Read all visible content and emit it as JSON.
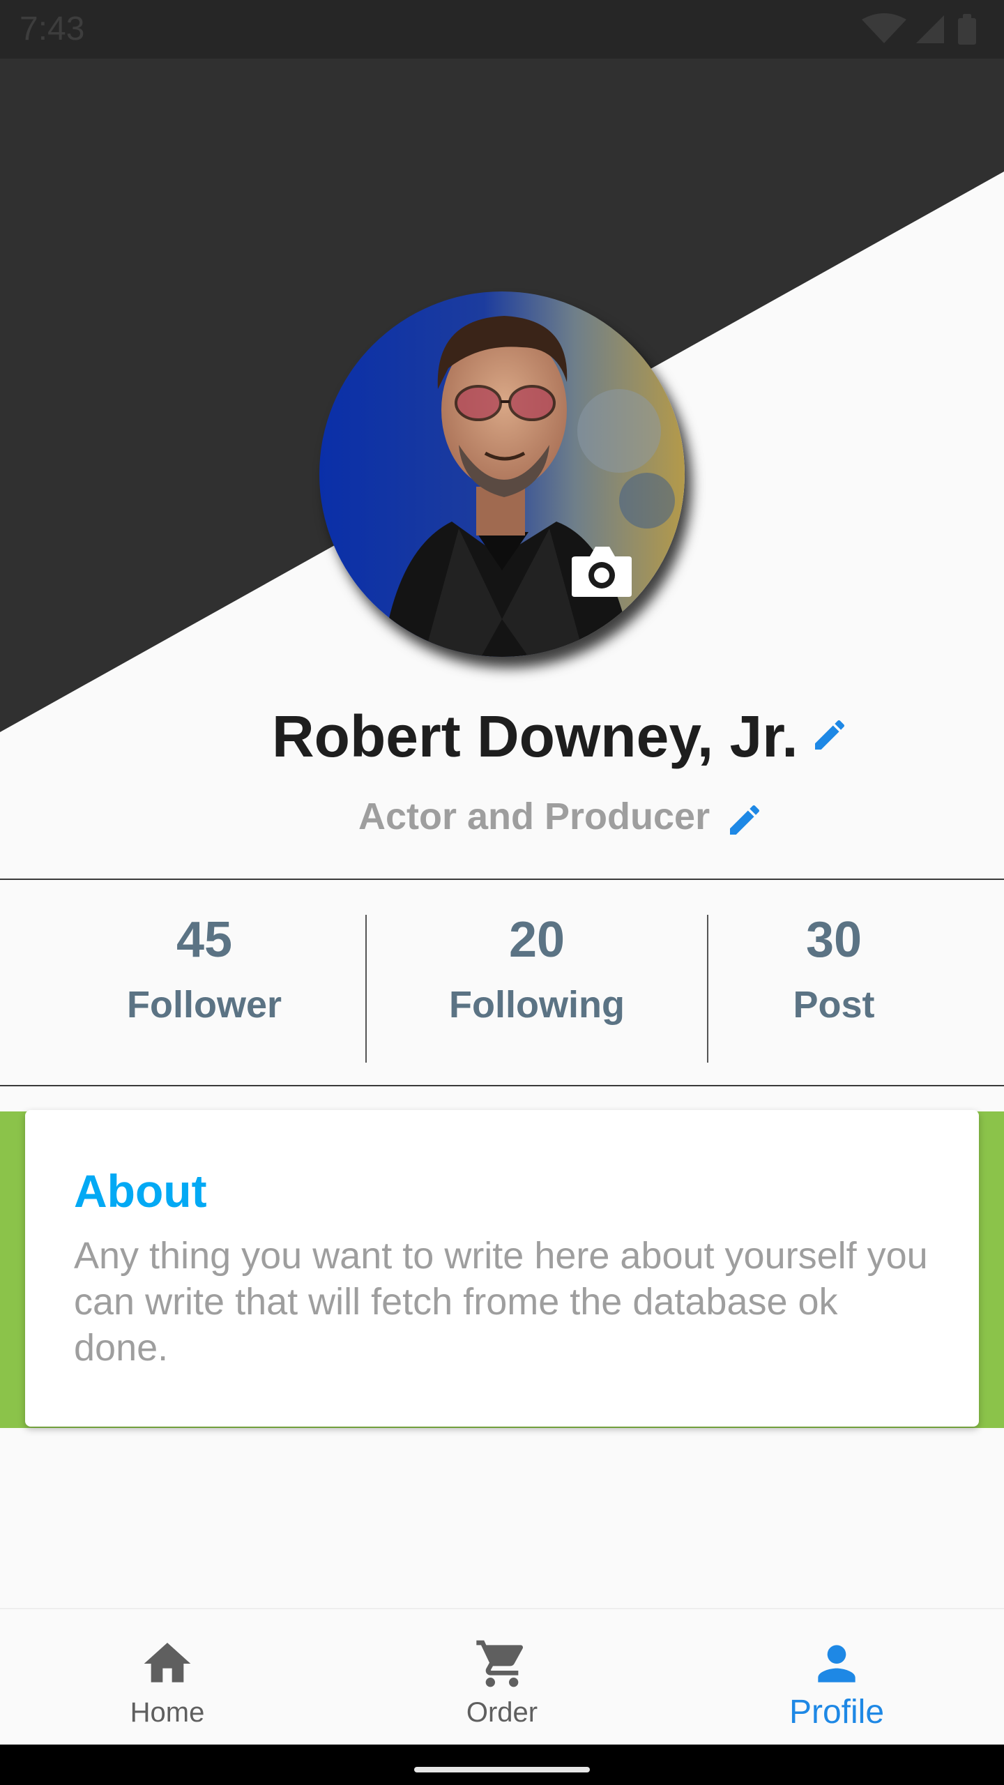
{
  "status_bar": {
    "time": "7:43",
    "icons": [
      "wifi-icon",
      "signal-icon",
      "battery-icon"
    ]
  },
  "profile": {
    "name": "Robert Downey, Jr.",
    "title": "Actor and Producer",
    "avatar_icon": "camera-icon"
  },
  "stats": [
    {
      "value": "45",
      "label": "Follower"
    },
    {
      "value": "20",
      "label": "Following"
    },
    {
      "value": "30",
      "label": "Post"
    }
  ],
  "about": {
    "heading": "About",
    "body": "Any thing you want to write here about yourself you can write that will fetch frome the database ok done."
  },
  "bottom_nav": {
    "items": [
      {
        "label": "Home",
        "icon": "home-icon",
        "active": false
      },
      {
        "label": "Order",
        "icon": "cart-icon",
        "active": false
      },
      {
        "label": "Profile",
        "icon": "person-icon",
        "active": true
      }
    ]
  },
  "colors": {
    "header_dark": "#303030",
    "accent_blue": "#1e88e5",
    "about_heading": "#03a9f4",
    "about_band": "#8bc34a",
    "stat_text": "#5b7384"
  }
}
